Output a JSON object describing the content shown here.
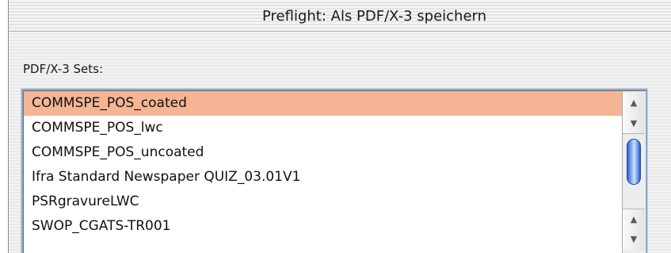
{
  "window": {
    "title": "Preflight: Als PDF/X-3 speichern"
  },
  "sets": {
    "label": "PDF/X-3 Sets:",
    "items": [
      {
        "label": "COMMSPE_POS_coated"
      },
      {
        "label": "COMMSPE_POS_lwc"
      },
      {
        "label": "COMMSPE_POS_uncoated"
      },
      {
        "label": "Ifra Standard Newspaper QUIZ_03.01V1"
      },
      {
        "label": "PSRgravureLWC"
      },
      {
        "label": "SWOP_CGATS-TR001"
      }
    ],
    "selected_index": 0,
    "selection_color": "#f5b594"
  },
  "scrollbar": {
    "up_icon": "arrow-up-icon",
    "down_icon": "arrow-down-icon",
    "thumb_color": "#4f86db"
  }
}
